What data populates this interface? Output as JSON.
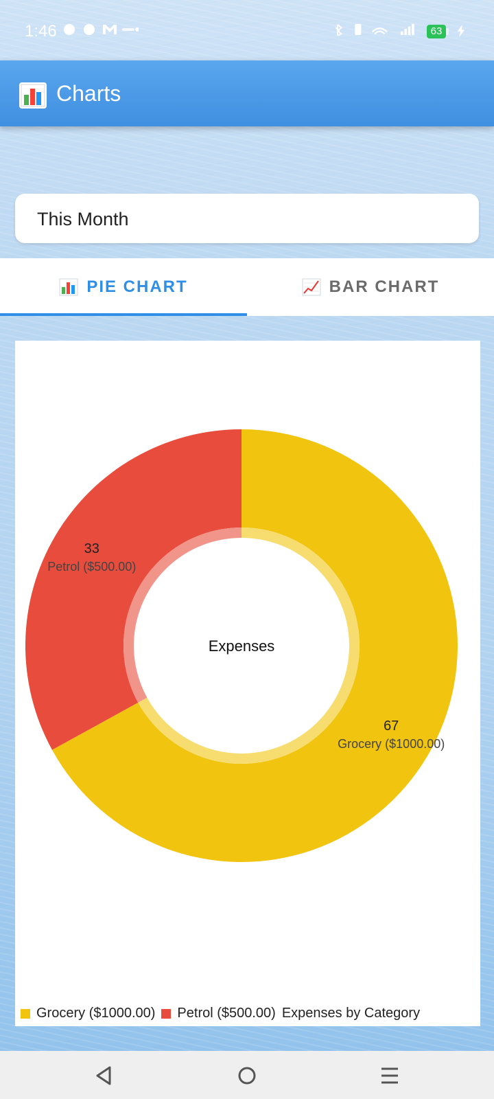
{
  "status": {
    "time": "1:46",
    "battery": "63"
  },
  "app": {
    "title": "Charts",
    "icon": "bar-chart-icon"
  },
  "period": {
    "value": "This Month"
  },
  "tabs": [
    {
      "label": "PIE CHART",
      "icon": "bar-chart-icon",
      "active": true
    },
    {
      "label": "BAR CHART",
      "icon": "line-chart-icon",
      "active": false
    }
  ],
  "chart_data": {
    "type": "pie",
    "center_label": "Expenses",
    "description": "Expenses by Category",
    "slices": [
      {
        "label": "Grocery ($1000.00)",
        "value": 67,
        "color": "#f1c40f"
      },
      {
        "label": "Petrol ($500.00)",
        "value": 33,
        "color": "#e74c3c"
      }
    ],
    "legend_position": "bottom-left"
  },
  "legend": {
    "items": [
      "Grocery ($1000.00)",
      "Petrol ($500.00)"
    ],
    "description": "Expenses by Category"
  }
}
